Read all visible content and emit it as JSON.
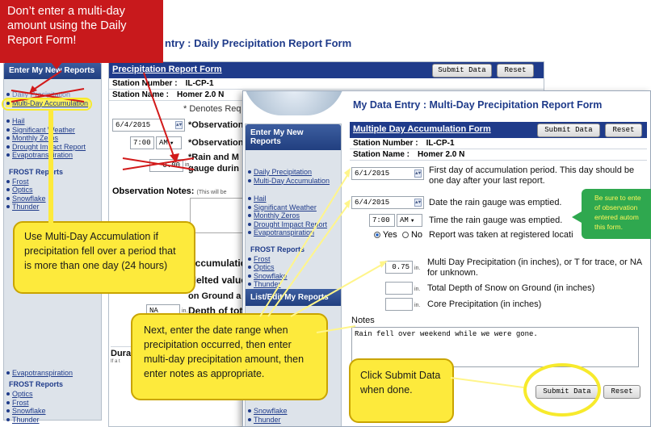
{
  "back_window": {
    "title": "My Data Entry : Daily Precipitation Report Form",
    "title_visible_part": "ntry : Daily Precipitation Report Form",
    "sidebar": {
      "header": "Enter My New Reports",
      "links_top": [
        "Daily Precipitation",
        "Multi-Day Accumulation"
      ],
      "links_mid": [
        "Hail",
        "Significant Weather",
        "Monthly Zeros",
        "Drought Impact Report",
        "Evapotranspiration"
      ],
      "frost_title": "FROST Reports",
      "frost_links": [
        "Frost",
        "Optics",
        "Snowflake",
        "Thunder"
      ],
      "links_low": [
        "Evapotranspiration"
      ],
      "frost_title_2": "FROST Reports",
      "frost_links_2": [
        "Optics",
        "Frost",
        "Snowflake",
        "Thunder"
      ]
    },
    "form": {
      "header": "Precipitation Report Form",
      "submit": "Submit Data",
      "reset": "Reset",
      "station_number_label": "Station Number :",
      "station_number": "IL-CP-1",
      "station_name_label": "Station Name :",
      "station_name": "Homer 2.0 N",
      "required_note": "* Denotes Req",
      "date_value": "6/4/2015",
      "obs_label_1": "*Observation",
      "time_value": "7:00",
      "ampm": "AM",
      "obs_label_2": "*Observation",
      "rain_label_1": "*Rain and M",
      "rain_label_2": "gauge durin",
      "rain_value": "0.00",
      "rain_unit": "in.",
      "notes_label": "Observation Notes:",
      "notes_hint": "(This will be",
      "accum_label": "Accumulatic",
      "melted_label": "Melted value",
      "ground_label": "on Ground a",
      "depth_value": "NA",
      "depth_unit": "in.",
      "depth_label": "Depth of tot",
      "dura_label": "Dura",
      "dura_hint": "If a t"
    }
  },
  "front_window": {
    "title": "My Data Entry : Multi-Day Precipitation Report Form",
    "sidebar": {
      "header": "Enter My New Reports",
      "links_top": [
        "Daily Precipitation",
        "Multi-Day Accumulation"
      ],
      "links_mid": [
        "Hail",
        "Significant Weather",
        "Monthly Zeros",
        "Drought Impact Report",
        "Evapotranspiration"
      ],
      "frost_title": "FROST Reports",
      "frost_links": [
        "Frost",
        "Optics",
        "Snowflake",
        "Thunder"
      ],
      "list_header": "List/Edit My Reports",
      "bottom_links": [
        "Snowflake",
        "Thunder"
      ]
    },
    "form": {
      "header": "Multiple Day Accumulation Form",
      "submit": "Submit Data",
      "reset": "Reset",
      "station_number_label": "Station Number :",
      "station_number": "IL-CP-1",
      "station_name_label": "Station Name :",
      "station_name": "Homer 2.0 N",
      "first_day_value": "6/1/2015",
      "first_day_label": "First day of accumulation period. This day should be one day after your last report.",
      "emptied_value": "6/4/2015",
      "emptied_label": "Date the rain gauge was emptied.",
      "time_value": "7:00",
      "ampm": "AM",
      "time_label": "Time the rain gauge was emptied.",
      "yes_label": "Yes",
      "no_label": "No",
      "registered_label": "Report was taken at registered locati",
      "multi_value": "0.75",
      "unit": "in.",
      "multi_label": "Multi Day Precipitation (in inches), or T for trace, or NA for unknown.",
      "snow_label": "Total Depth of Snow on Ground (in inches)",
      "core_label": "Core Precipitation (in inches)",
      "notes_label": "Notes",
      "notes_value": "Rain fell over weekend while we were gone."
    },
    "green_tip": "Be sure to ente of observation entered autom this form."
  },
  "annotations": {
    "red_banner": "Don’t enter a multi-day amount using the Daily Report Form!",
    "callout_accum": "Use Multi-Day Accumulation if precipitation fell over a period that is more than one day (24 hours)",
    "callout_range": "Next, enter the date range when precipitation occurred, then enter multi-day precipitation amount, then enter notes as appropriate.",
    "callout_submit": "Click Submit Data when done."
  },
  "colors": {
    "nav_blue": "#1f3b8a",
    "banner_red": "#c8191c",
    "callout_yellow": "#fdea3c",
    "tip_green": "#2fa84f"
  }
}
